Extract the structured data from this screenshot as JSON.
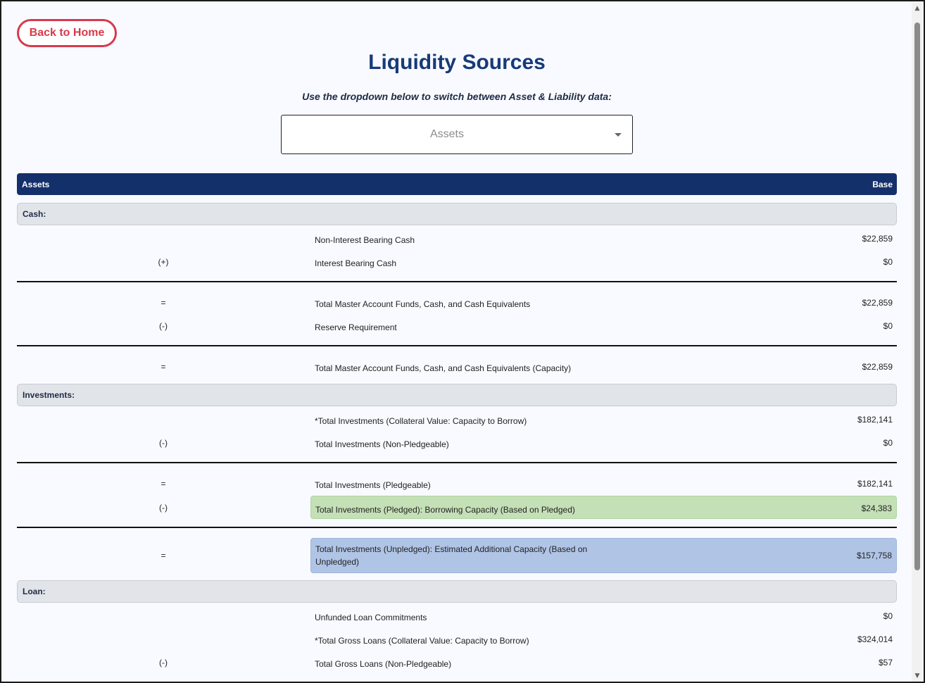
{
  "header": {
    "back_label": "Back to Home",
    "title": "Liquidity Sources",
    "instruction": "Use the dropdown below to switch between Asset & Liability data:"
  },
  "dropdown": {
    "selected": "Assets"
  },
  "table": {
    "col_left": "Assets",
    "col_right": "Base",
    "sections": {
      "cash": "Cash:",
      "investments": "Investments:",
      "loan": "Loan:"
    },
    "rows": [
      {
        "op": "",
        "label": "Non-Interest Bearing Cash",
        "value": "$22,859"
      },
      {
        "op": "(+)",
        "label": "Interest Bearing Cash",
        "value": "$0"
      },
      {
        "op": "=",
        "label": "Total Master Account Funds, Cash, and Cash Equivalents",
        "value": "$22,859"
      },
      {
        "op": "(-)",
        "label": "Reserve Requirement",
        "value": "$0"
      },
      {
        "op": "=",
        "label": "Total Master Account Funds, Cash, and Cash Equivalents (Capacity)",
        "value": "$22,859"
      },
      {
        "op": "",
        "label": "*Total Investments (Collateral Value: Capacity to Borrow)",
        "value": "$182,141"
      },
      {
        "op": "(-)",
        "label": "Total Investments (Non-Pledgeable)",
        "value": "$0"
      },
      {
        "op": "=",
        "label": "Total Investments (Pledgeable)",
        "value": "$182,141"
      },
      {
        "op": "(-)",
        "label": "Total Investments (Pledged): Borrowing Capacity (Based on Pledged)",
        "value": "$24,383"
      },
      {
        "op": "=",
        "label": "Total Investments (Unpledged): Estimated Additional Capacity (Based on Unpledged)",
        "value": "$157,758"
      },
      {
        "op": "",
        "label": "Unfunded Loan Commitments",
        "value": "$0"
      },
      {
        "op": "",
        "label": "*Total Gross Loans (Collateral Value: Capacity to Borrow)",
        "value": "$324,014"
      },
      {
        "op": "(-)",
        "label": "Total Gross Loans (Non-Pledgeable)",
        "value": "$57"
      }
    ]
  },
  "colors": {
    "primary": "#14306b",
    "accent": "#d63a4d",
    "highlight_green": "#c4e0b6",
    "highlight_blue": "#b0c4e6"
  }
}
